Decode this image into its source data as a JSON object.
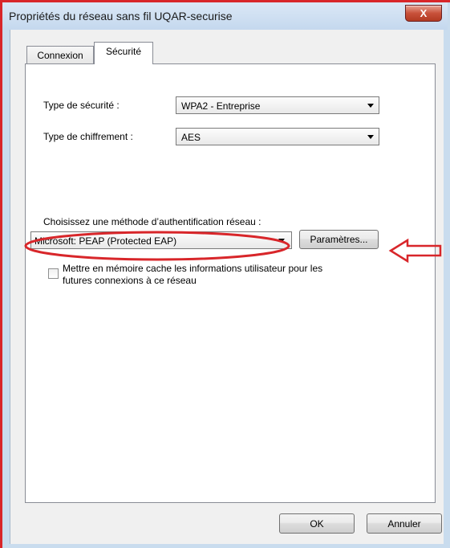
{
  "window": {
    "title": "Propriétés du réseau sans fil UQAR-securise",
    "close_glyph": "X"
  },
  "tabs": [
    {
      "label": "Connexion",
      "active": false
    },
    {
      "label": "Sécurité",
      "active": true
    }
  ],
  "security": {
    "type_label": "Type de sécurité :",
    "type_value": "WPA2 - Entreprise",
    "encryption_label": "Type de chiffrement :",
    "encryption_value": "AES"
  },
  "auth": {
    "label": "Choisissez une méthode d’authentification réseau :",
    "method_value": "Microsoft: PEAP (Protected EAP)",
    "settings_button": "Paramètres...",
    "cache_checkbox_line1": "Mettre en mémoire cache les informations utilisateur pour les",
    "cache_checkbox_line2": "futures connexions à ce réseau",
    "cache_checked": false
  },
  "footer": {
    "ok_label": "OK",
    "cancel_label": "Annuler"
  },
  "colors": {
    "annotation_red": "#d8262a",
    "title_bar": "#c4d8ee"
  },
  "icons": {
    "close": "close-icon",
    "dropdown": "chevron-down-icon",
    "annotation_arrow": "arrow-left-icon"
  }
}
